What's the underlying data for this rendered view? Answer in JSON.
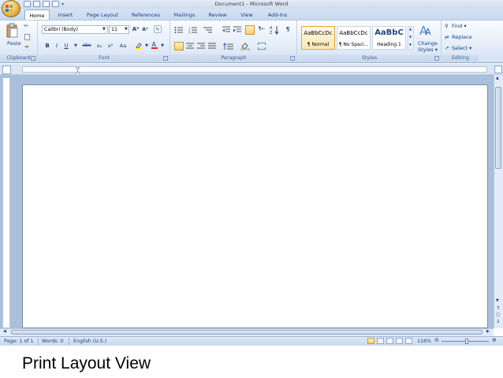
{
  "window": {
    "title": "Document1 - Microsoft Word"
  },
  "tabs": [
    {
      "label": "Home",
      "active": true
    },
    {
      "label": "Insert"
    },
    {
      "label": "Page Layout"
    },
    {
      "label": "References"
    },
    {
      "label": "Mailings"
    },
    {
      "label": "Review"
    },
    {
      "label": "View"
    },
    {
      "label": "Add-Ins"
    }
  ],
  "ribbon": {
    "clipboard": {
      "label": "Clipboard",
      "paste_label": "Paste"
    },
    "font": {
      "label": "Font",
      "font_name": "Calibri (Body)",
      "font_size": "11",
      "bold": "B",
      "italic": "I",
      "underline": "U",
      "strikethrough": "abe",
      "subscript": "x₂",
      "superscript": "x²",
      "change_case": "Aa"
    },
    "paragraph": {
      "label": "Paragraph",
      "show_marks": "¶"
    },
    "styles": {
      "label": "Styles",
      "items": [
        {
          "sample": "AaBbCcDc",
          "name": "¶ Normal"
        },
        {
          "sample": "AaBbCcDc",
          "name": "¶ No Spaci..."
        },
        {
          "sample": "AaBbC",
          "name": "Heading 1"
        }
      ],
      "change_styles_line1": "Change",
      "change_styles_line2": "Styles ▾"
    },
    "editing": {
      "label": "Editing",
      "find": "Find ▾",
      "replace": "Replace",
      "select": "Select ▾"
    }
  },
  "status": {
    "page": "Page: 1 of 1",
    "words": "Words: 0",
    "language": "English (U.S.)",
    "zoom": "116%"
  },
  "caption": "Print Layout View",
  "colors": {
    "ribbon_text": "#15428b",
    "workspace": "#a9bfdc",
    "accent": "#e4a33a"
  }
}
